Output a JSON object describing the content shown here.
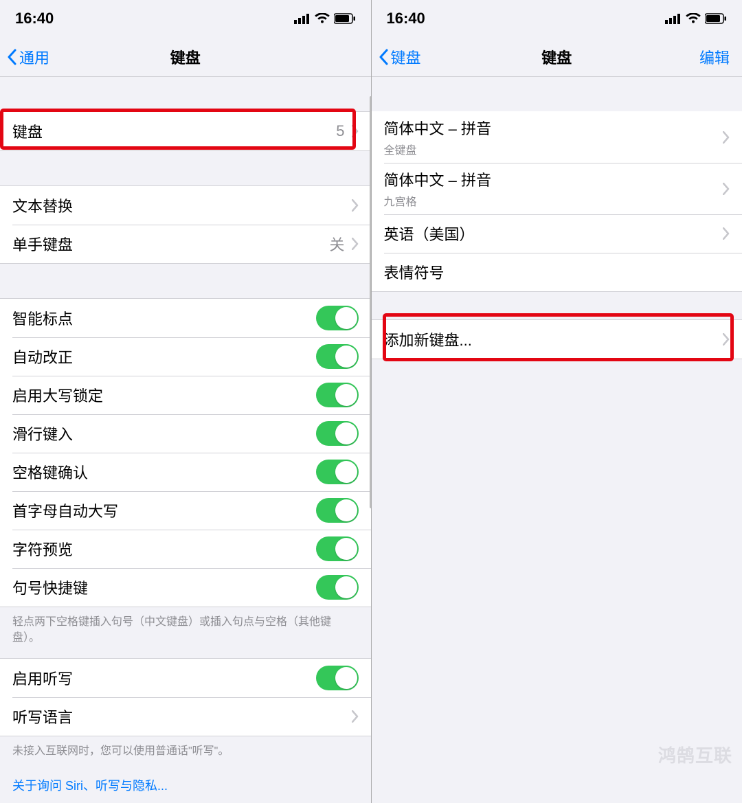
{
  "left": {
    "status": {
      "time": "16:40"
    },
    "nav": {
      "back": "通用",
      "title": "键盘"
    },
    "row_keyboard": {
      "label": "键盘",
      "value": "5"
    },
    "row_text_replace": {
      "label": "文本替换"
    },
    "row_onehand": {
      "label": "单手键盘",
      "value": "关"
    },
    "toggles": [
      {
        "label": "智能标点"
      },
      {
        "label": "自动改正"
      },
      {
        "label": "启用大写锁定"
      },
      {
        "label": "滑行键入"
      },
      {
        "label": "空格键确认"
      },
      {
        "label": "首字母自动大写"
      },
      {
        "label": "字符预览"
      },
      {
        "label": "句号快捷键"
      }
    ],
    "footer1": "轻点两下空格键插入句号（中文键盘）或插入句点与空格（其他键盘）。",
    "row_dictation": {
      "label": "启用听写"
    },
    "row_dictation_lang": {
      "label": "听写语言"
    },
    "footer2": "未接入互联网时，您可以使用普通话\"听写\"。",
    "link": "关于询问 Siri、听写与隐私..."
  },
  "right": {
    "status": {
      "time": "16:40"
    },
    "nav": {
      "back": "键盘",
      "title": "键盘",
      "edit": "编辑"
    },
    "keyboards": [
      {
        "label": "简体中文 – 拼音",
        "sub": "全键盘",
        "chevron": true
      },
      {
        "label": "简体中文 – 拼音",
        "sub": "九宫格",
        "chevron": true
      },
      {
        "label": "英语（美国）",
        "sub": "",
        "chevron": true
      },
      {
        "label": "表情符号",
        "sub": "",
        "chevron": false
      }
    ],
    "add_new": {
      "label": "添加新键盘..."
    },
    "watermark": "鸿鹄互联"
  }
}
